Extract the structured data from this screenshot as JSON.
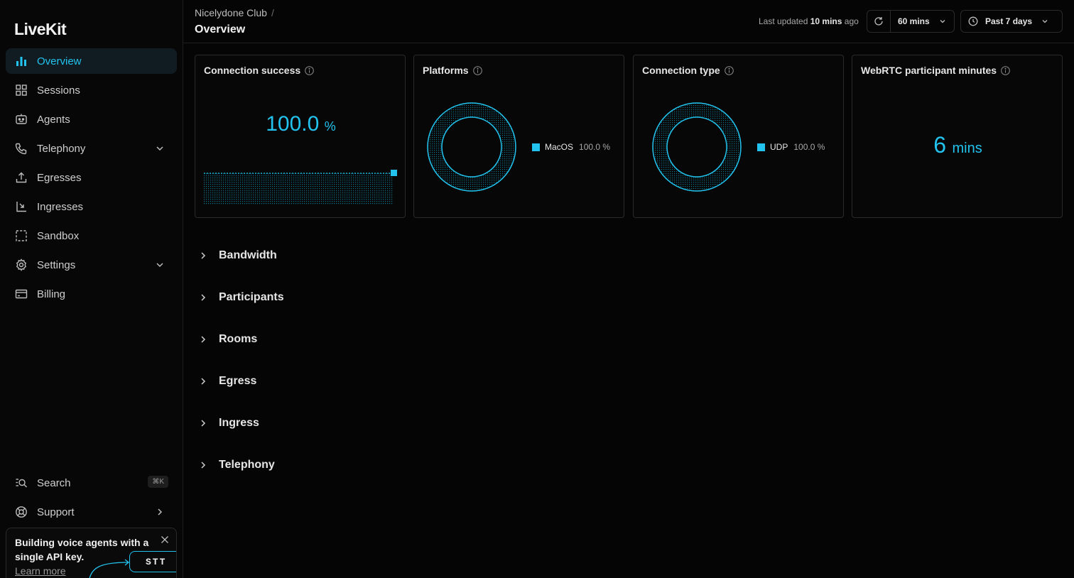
{
  "brand": {
    "name": "LiveKit",
    "accent": "#22c3ee"
  },
  "sidebar": {
    "items": [
      {
        "label": "Overview",
        "icon": "bar-chart-icon",
        "active": true
      },
      {
        "label": "Sessions",
        "icon": "grid-icon"
      },
      {
        "label": "Agents",
        "icon": "robot-icon"
      },
      {
        "label": "Telephony",
        "icon": "phone-icon",
        "expandable": true
      },
      {
        "label": "Egresses",
        "icon": "upload-icon"
      },
      {
        "label": "Ingresses",
        "icon": "download-corner-icon"
      },
      {
        "label": "Sandbox",
        "icon": "dashed-square-icon"
      },
      {
        "label": "Settings",
        "icon": "gear-icon",
        "expandable": true
      },
      {
        "label": "Billing",
        "icon": "card-icon"
      }
    ],
    "search": {
      "label": "Search",
      "shortcut": "⌘K"
    },
    "support": {
      "label": "Support"
    }
  },
  "promo": {
    "text": "Building voice agents with a single API key.",
    "link": "Learn more",
    "tag": "STT"
  },
  "header": {
    "breadcrumb": "Nicelydone Club",
    "separator": "/",
    "title": "Overview",
    "updated_prefix": "Last updated",
    "updated_value": "10 mins",
    "updated_suffix": "ago",
    "refresh_interval": "60 mins",
    "range": "Past 7 days"
  },
  "cards": {
    "connection_success": {
      "title": "Connection success",
      "value": "100.0",
      "unit": "%"
    },
    "platforms": {
      "title": "Platforms",
      "legend": [
        {
          "label": "MacOS",
          "pct": "100.0 %"
        }
      ]
    },
    "connection_type": {
      "title": "Connection type",
      "legend": [
        {
          "label": "UDP",
          "pct": "100.0 %"
        }
      ]
    },
    "webrtc_minutes": {
      "title": "WebRTC participant minutes",
      "value": "6",
      "unit": "mins"
    }
  },
  "sections": [
    "Bandwidth",
    "Participants",
    "Rooms",
    "Egress",
    "Ingress",
    "Telephony"
  ]
}
